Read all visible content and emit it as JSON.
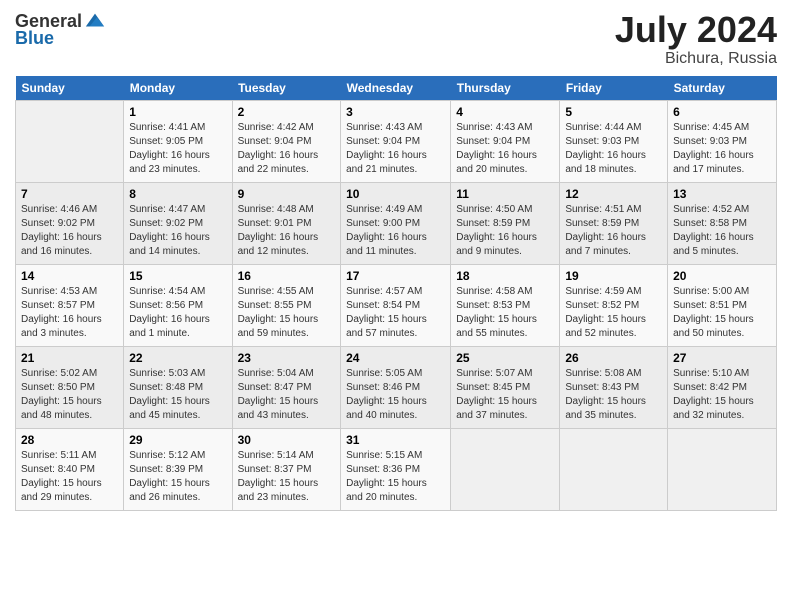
{
  "header": {
    "logo_general": "General",
    "logo_blue": "Blue",
    "main_title": "July 2024",
    "sub_title": "Bichura, Russia"
  },
  "days_of_week": [
    "Sunday",
    "Monday",
    "Tuesday",
    "Wednesday",
    "Thursday",
    "Friday",
    "Saturday"
  ],
  "weeks": [
    [
      {
        "day": "",
        "content": ""
      },
      {
        "day": "1",
        "content": "Sunrise: 4:41 AM\nSunset: 9:05 PM\nDaylight: 16 hours\nand 23 minutes."
      },
      {
        "day": "2",
        "content": "Sunrise: 4:42 AM\nSunset: 9:04 PM\nDaylight: 16 hours\nand 22 minutes."
      },
      {
        "day": "3",
        "content": "Sunrise: 4:43 AM\nSunset: 9:04 PM\nDaylight: 16 hours\nand 21 minutes."
      },
      {
        "day": "4",
        "content": "Sunrise: 4:43 AM\nSunset: 9:04 PM\nDaylight: 16 hours\nand 20 minutes."
      },
      {
        "day": "5",
        "content": "Sunrise: 4:44 AM\nSunset: 9:03 PM\nDaylight: 16 hours\nand 18 minutes."
      },
      {
        "day": "6",
        "content": "Sunrise: 4:45 AM\nSunset: 9:03 PM\nDaylight: 16 hours\nand 17 minutes."
      }
    ],
    [
      {
        "day": "7",
        "content": "Sunrise: 4:46 AM\nSunset: 9:02 PM\nDaylight: 16 hours\nand 16 minutes."
      },
      {
        "day": "8",
        "content": "Sunrise: 4:47 AM\nSunset: 9:02 PM\nDaylight: 16 hours\nand 14 minutes."
      },
      {
        "day": "9",
        "content": "Sunrise: 4:48 AM\nSunset: 9:01 PM\nDaylight: 16 hours\nand 12 minutes."
      },
      {
        "day": "10",
        "content": "Sunrise: 4:49 AM\nSunset: 9:00 PM\nDaylight: 16 hours\nand 11 minutes."
      },
      {
        "day": "11",
        "content": "Sunrise: 4:50 AM\nSunset: 8:59 PM\nDaylight: 16 hours\nand 9 minutes."
      },
      {
        "day": "12",
        "content": "Sunrise: 4:51 AM\nSunset: 8:59 PM\nDaylight: 16 hours\nand 7 minutes."
      },
      {
        "day": "13",
        "content": "Sunrise: 4:52 AM\nSunset: 8:58 PM\nDaylight: 16 hours\nand 5 minutes."
      }
    ],
    [
      {
        "day": "14",
        "content": "Sunrise: 4:53 AM\nSunset: 8:57 PM\nDaylight: 16 hours\nand 3 minutes."
      },
      {
        "day": "15",
        "content": "Sunrise: 4:54 AM\nSunset: 8:56 PM\nDaylight: 16 hours\nand 1 minute."
      },
      {
        "day": "16",
        "content": "Sunrise: 4:55 AM\nSunset: 8:55 PM\nDaylight: 15 hours\nand 59 minutes."
      },
      {
        "day": "17",
        "content": "Sunrise: 4:57 AM\nSunset: 8:54 PM\nDaylight: 15 hours\nand 57 minutes."
      },
      {
        "day": "18",
        "content": "Sunrise: 4:58 AM\nSunset: 8:53 PM\nDaylight: 15 hours\nand 55 minutes."
      },
      {
        "day": "19",
        "content": "Sunrise: 4:59 AM\nSunset: 8:52 PM\nDaylight: 15 hours\nand 52 minutes."
      },
      {
        "day": "20",
        "content": "Sunrise: 5:00 AM\nSunset: 8:51 PM\nDaylight: 15 hours\nand 50 minutes."
      }
    ],
    [
      {
        "day": "21",
        "content": "Sunrise: 5:02 AM\nSunset: 8:50 PM\nDaylight: 15 hours\nand 48 minutes."
      },
      {
        "day": "22",
        "content": "Sunrise: 5:03 AM\nSunset: 8:48 PM\nDaylight: 15 hours\nand 45 minutes."
      },
      {
        "day": "23",
        "content": "Sunrise: 5:04 AM\nSunset: 8:47 PM\nDaylight: 15 hours\nand 43 minutes."
      },
      {
        "day": "24",
        "content": "Sunrise: 5:05 AM\nSunset: 8:46 PM\nDaylight: 15 hours\nand 40 minutes."
      },
      {
        "day": "25",
        "content": "Sunrise: 5:07 AM\nSunset: 8:45 PM\nDaylight: 15 hours\nand 37 minutes."
      },
      {
        "day": "26",
        "content": "Sunrise: 5:08 AM\nSunset: 8:43 PM\nDaylight: 15 hours\nand 35 minutes."
      },
      {
        "day": "27",
        "content": "Sunrise: 5:10 AM\nSunset: 8:42 PM\nDaylight: 15 hours\nand 32 minutes."
      }
    ],
    [
      {
        "day": "28",
        "content": "Sunrise: 5:11 AM\nSunset: 8:40 PM\nDaylight: 15 hours\nand 29 minutes."
      },
      {
        "day": "29",
        "content": "Sunrise: 5:12 AM\nSunset: 8:39 PM\nDaylight: 15 hours\nand 26 minutes."
      },
      {
        "day": "30",
        "content": "Sunrise: 5:14 AM\nSunset: 8:37 PM\nDaylight: 15 hours\nand 23 minutes."
      },
      {
        "day": "31",
        "content": "Sunrise: 5:15 AM\nSunset: 8:36 PM\nDaylight: 15 hours\nand 20 minutes."
      },
      {
        "day": "",
        "content": ""
      },
      {
        "day": "",
        "content": ""
      },
      {
        "day": "",
        "content": ""
      }
    ]
  ]
}
